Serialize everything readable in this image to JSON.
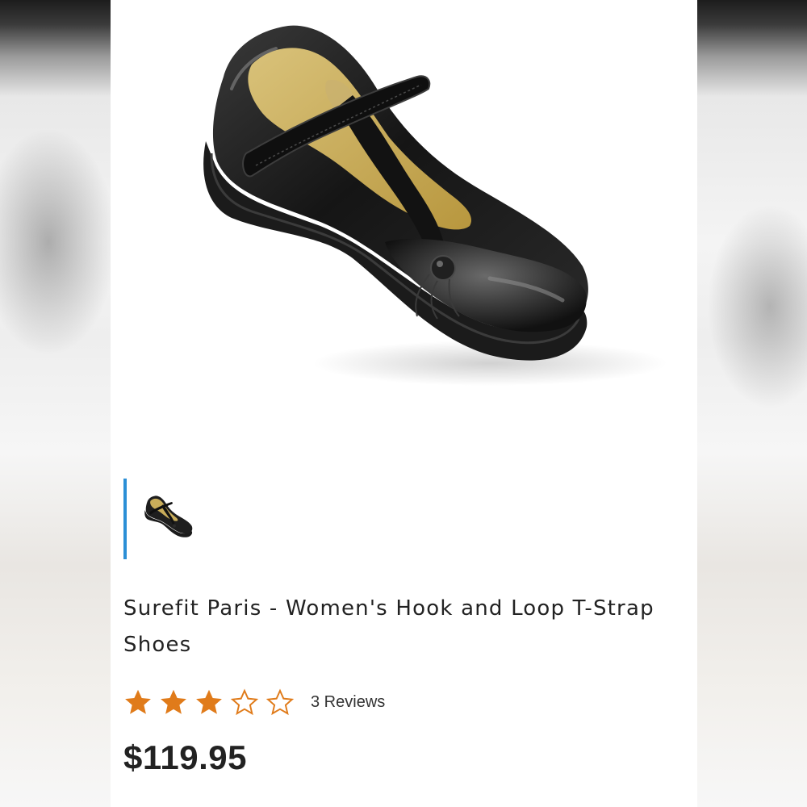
{
  "product": {
    "title": "Surefit Paris - Women's Hook and Loop T-Strap Shoes",
    "rating": {
      "value": 3,
      "max": 5,
      "reviews_label": "3 Reviews"
    },
    "price": "$119.95",
    "image_alt": "Black leather T-strap shoe",
    "thumbnails": [
      {
        "label": "Black leather T-strap shoe",
        "selected": true
      }
    ]
  },
  "colors": {
    "star_filled": "#e07b1a",
    "star_empty_stroke": "#e07b1a",
    "thumb_indicator": "#2b8fd6",
    "text_primary": "#222222"
  },
  "icons": {
    "star_filled": "star-filled-icon",
    "star_empty": "star-outline-icon"
  }
}
